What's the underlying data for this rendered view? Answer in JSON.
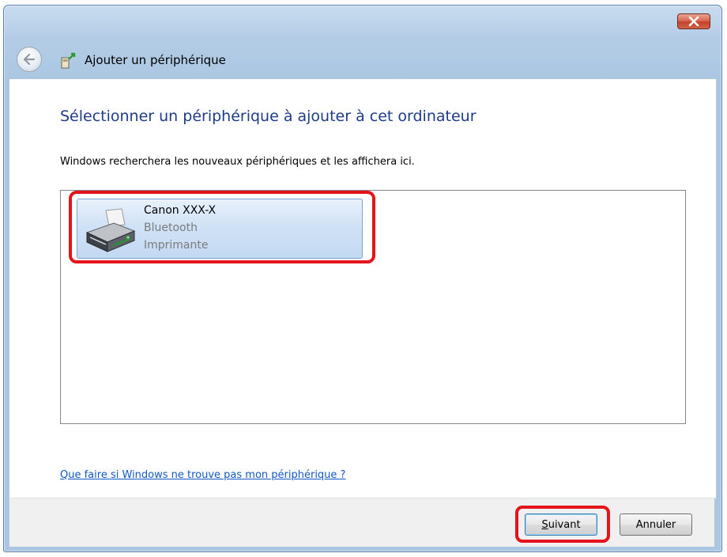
{
  "window": {
    "title": "Ajouter un périphérique",
    "close_icon": "close-icon"
  },
  "main": {
    "heading": "Sélectionner un périphérique à ajouter à cet ordinateur",
    "description": "Windows recherchera les nouveaux périphériques et les affichera ici.",
    "devices": [
      {
        "name": "Canon XXX-X",
        "connection": "Bluetooth",
        "type": "Imprimante",
        "icon": "printer-icon",
        "selected": true
      }
    ],
    "help_link": "Que faire si Windows ne trouve pas mon périphérique ?"
  },
  "footer": {
    "next_label_mnemonic": "S",
    "next_label_rest": "uivant",
    "cancel_label": "Annuler"
  },
  "colors": {
    "heading": "#1e3b8a",
    "link": "#1358c4",
    "highlight": "#e4151a",
    "selection": "#c3d9f2"
  }
}
